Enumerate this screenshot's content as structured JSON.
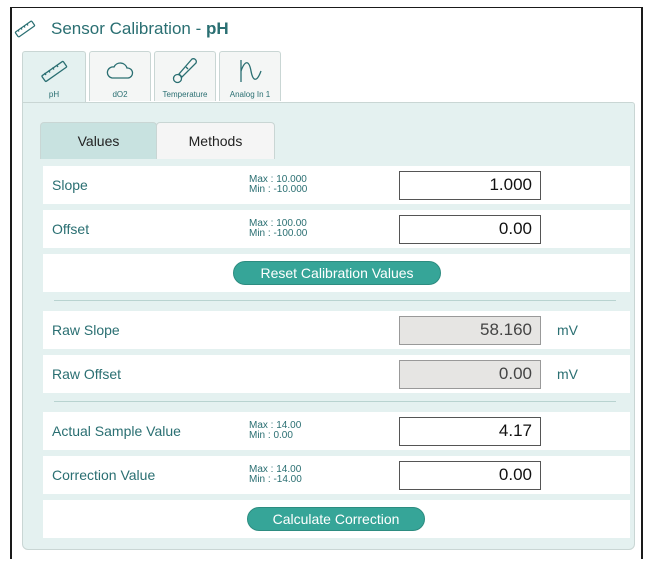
{
  "title": {
    "prefix": "Sensor Calibration - ",
    "sensor": "pH"
  },
  "sensor_tabs": [
    {
      "label": "pH",
      "icon": "thermometer-ruler-icon",
      "active": true
    },
    {
      "label": "dO2",
      "icon": "cloud-icon",
      "active": false
    },
    {
      "label": "Temperature",
      "icon": "thermometer-icon",
      "active": false
    },
    {
      "label": "Analog In 1",
      "icon": "waveform-icon",
      "active": false
    }
  ],
  "main_tabs": {
    "values": "Values",
    "methods": "Methods"
  },
  "slope": {
    "label": "Slope",
    "max": "Max  : 10.000",
    "min": "Min   : -10.000",
    "value": "1.000"
  },
  "offset": {
    "label": "Offset",
    "max": "Max  : 100.00",
    "min": "Min   : -100.00",
    "value": "0.00"
  },
  "reset_button": "Reset Calibration Values",
  "raw_slope": {
    "label": "Raw Slope",
    "value": "58.160",
    "unit": "mV"
  },
  "raw_offset": {
    "label": "Raw Offset",
    "value": "0.00",
    "unit": "mV"
  },
  "actual_sample": {
    "label": "Actual Sample Value",
    "max": "Max  : 14.00",
    "min": "Min   : 0.00",
    "value": "4.17"
  },
  "correction": {
    "label": "Correction Value",
    "max": "Max  : 14.00",
    "min": "Min   : -14.00",
    "value": "0.00"
  },
  "calculate_button": "Calculate Correction",
  "colors": {
    "accent": "#36a598",
    "text": "#2a6f72",
    "panel": "#e4f1f0"
  }
}
